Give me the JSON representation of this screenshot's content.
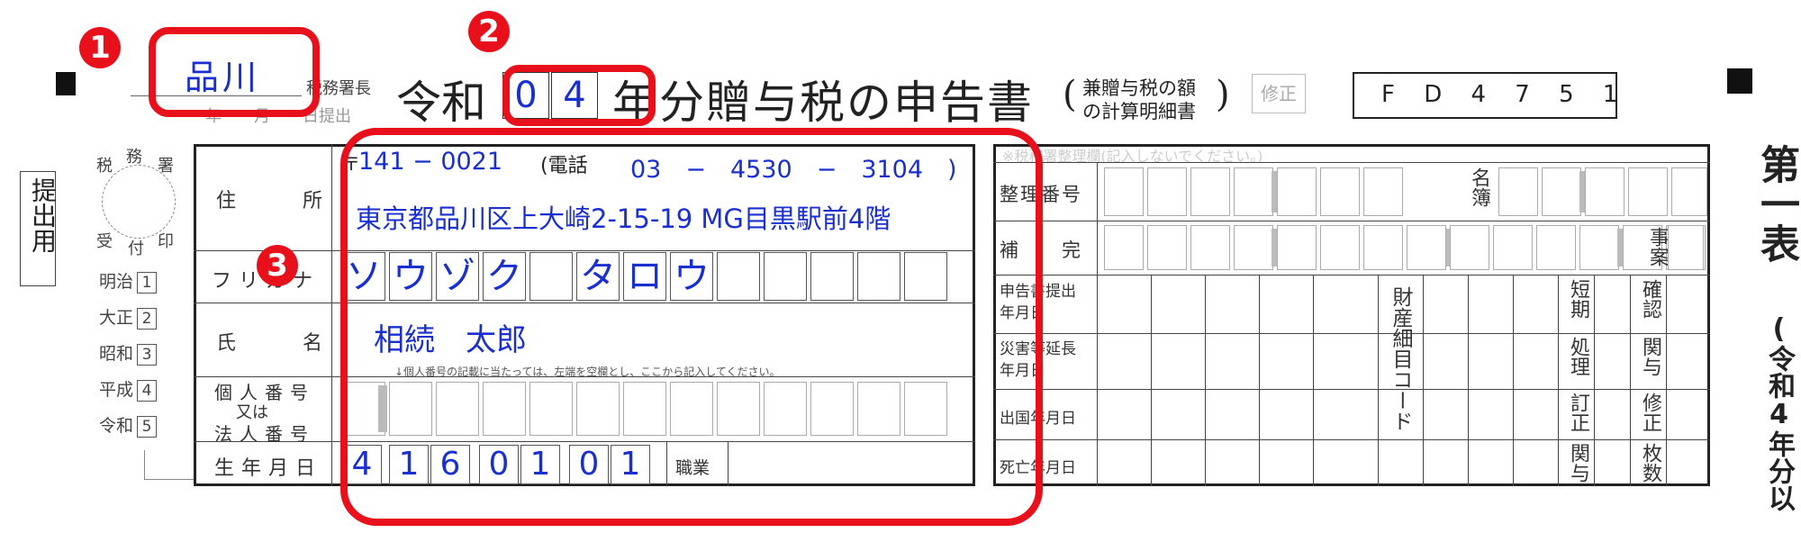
{
  "markers": [
    "1",
    "2",
    "3"
  ],
  "header": {
    "tax_office": "品川",
    "tax_office_suffix": "税務署長",
    "date_line": "年　　月　　日提出",
    "era": "令和",
    "year_digits": [
      "0",
      "4"
    ],
    "title": "年分贈与税の申告書",
    "title_paren_line1": "兼贈与税の額",
    "title_paren_line2": "の計算明細書",
    "paren_open": "(",
    "paren_close": ")",
    "correction_stamp": "修正",
    "form_code": "F D 4 7 5 1"
  },
  "left_margin": {
    "submit_label": "提出用",
    "stamp_labels": [
      "税",
      "務",
      "署",
      "受",
      "付",
      "印"
    ],
    "eras": [
      {
        "name": "明治",
        "num": "1"
      },
      {
        "name": "大正",
        "num": "2"
      },
      {
        "name": "昭和",
        "num": "3"
      },
      {
        "name": "平成",
        "num": "4"
      },
      {
        "name": "令和",
        "num": "5"
      }
    ]
  },
  "form": {
    "address_label": "住　　　所",
    "postal_mark": "〒",
    "postal_code": "141 − 0021",
    "phone_label": "(電話",
    "phone": "03　−　4530　−　3104　)",
    "address": "東京都品川区上大崎2-15-19 MG目黒駅前4階",
    "furigana_label": "フリガナ",
    "furigana": [
      "ソ",
      "ウ",
      "ゾ",
      "ク",
      "",
      "タ",
      "ロ",
      "ウ",
      "",
      "",
      "",
      "",
      ""
    ],
    "name_label": "氏　　　名",
    "name": "相続　太郎",
    "id_note": "↓個人番号の記載に当たっては、左端を空欄とし、ここから記入してください。",
    "id_label_1": "個人番号",
    "id_label_2": "又は",
    "id_label_3": "法人番号",
    "birth_label": "生年月日",
    "birth_digits": [
      "4",
      "1",
      "6",
      "0",
      "1",
      "0",
      "1"
    ],
    "occupation_label": "職業"
  },
  "office_panel": {
    "header_note": "※税務署整理欄(記入しないでください。)",
    "row1_label": "整理番号",
    "meibo": "名簿",
    "row2_label": "補　　完",
    "jian": "事案",
    "row3_label": "申告書提出年月日",
    "row4_label": "災害等延長年月日",
    "row5_label": "出国年月日",
    "row6_label": "死亡年月日",
    "zaisan": "財産細目コード",
    "tanki": "短期",
    "shori": "処理",
    "teisei": "訂正",
    "kanyo": "関与",
    "kakunin": "確認",
    "kanyo2": "関与",
    "shusei": "修正",
    "maisu": "枚数"
  },
  "right_margin": {
    "table_no": "第一表",
    "year_note": "(令和4年分以"
  },
  "colors": {
    "annotation_red": "#e8101a",
    "ink_blue": "#1a2fd0"
  }
}
